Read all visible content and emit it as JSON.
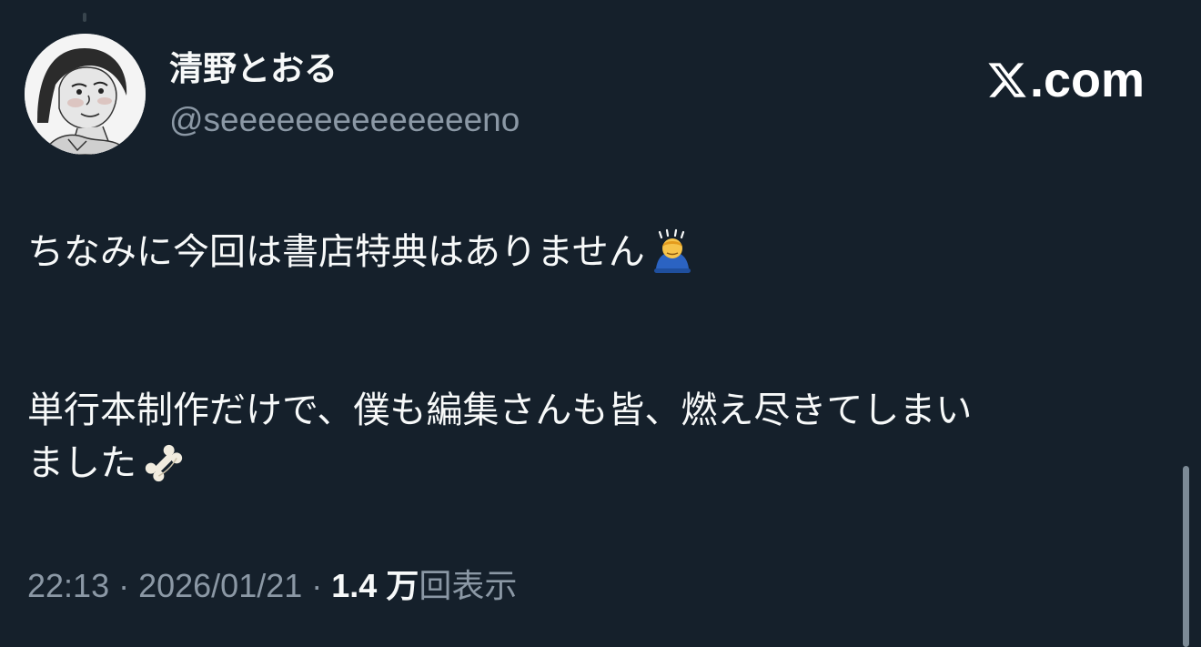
{
  "author": {
    "display_name": "清野とおる",
    "handle": "@seeeeeeeeeeeeeeno"
  },
  "brand": {
    "label": ".com"
  },
  "tweet": {
    "line1": "ちなみに今回は書店特典はありません",
    "line2": "単行本制作だけで、僕も編集さんも皆、燃え尽きてしまい",
    "line3": "ました",
    "emojis": [
      "person-bowing-icon",
      "bone-icon"
    ]
  },
  "meta": {
    "time": "22:13",
    "date": "2026/01/21",
    "separator": " · ",
    "views_count": "1.4 万",
    "views_label": "回表示"
  },
  "colors": {
    "background": "#15202b",
    "primary_text": "#f7f9f9",
    "secondary_text": "#8b98a5",
    "scrollbar": "#7c8a96"
  }
}
